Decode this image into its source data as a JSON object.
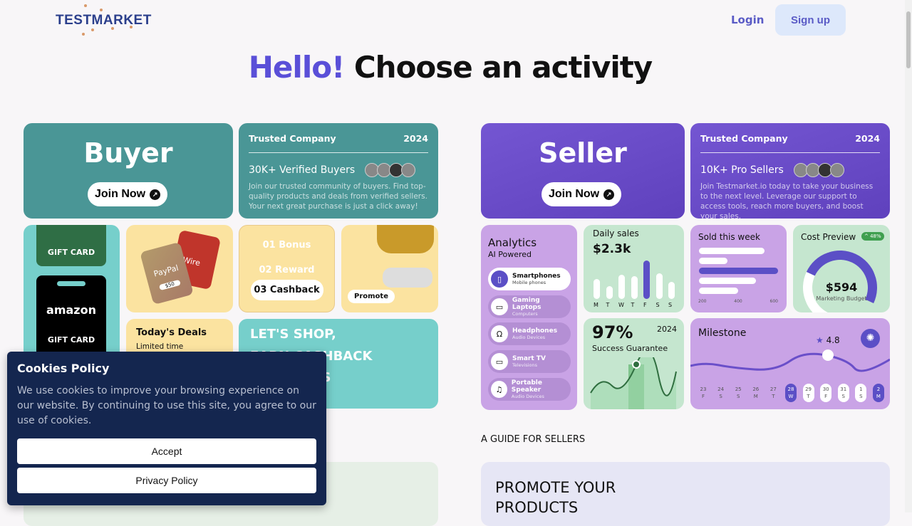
{
  "header": {
    "logo": "TESTMARKET",
    "login": "Login",
    "signup": "Sign up"
  },
  "hero": {
    "hello": "Hello!",
    "title": "Choose an activity"
  },
  "buyer": {
    "title": "Buyer",
    "join": "Join Now",
    "trusted": "Trusted Company",
    "year": "2024",
    "headline": "30K+ Verified Buyers",
    "desc": "Join our trusted community of buyers. Find top-quality products and deals from verified sellers. Your next great purchase is just a click away!",
    "giftcard1": "GIFT CARD",
    "amazon": "amazon",
    "giftcard2": "GIFT CARD",
    "paypal": "PayPal",
    "wire": "Wire",
    "amount": "$50",
    "bonus": "01 Bonus",
    "reward": "02 Reward",
    "cashback": "03 Cashback",
    "promote": "Promote",
    "deals": "Today's Deals",
    "limited": "Limited time",
    "shop1": "LET'S SHOP,",
    "shop2": "EARN CASHBACK",
    "shop3": "AND COINS"
  },
  "seller": {
    "title": "Seller",
    "join": "Join Now",
    "trusted": "Trusted Company",
    "year": "2024",
    "headline": "10K+ Pro Sellers",
    "desc": "Join Testmarket.io today to take your business to the next level. Leverage our support to access tools, reach more buyers, and boost your sales.",
    "analytics": "Analytics",
    "ai": "AI Powered",
    "items": [
      {
        "t": "Smartphones",
        "s": "Mobile phones",
        "icon": "phone"
      },
      {
        "t": "Gaming Laptops",
        "s": "Computers",
        "icon": "laptop"
      },
      {
        "t": "Headphones",
        "s": "Audio Devices",
        "icon": "headphones"
      },
      {
        "t": "Smart TV",
        "s": "Televisions",
        "icon": "tv"
      },
      {
        "t": "Portable Speaker",
        "s": "Audio Devices",
        "icon": "music"
      }
    ],
    "daily": "Daily sales",
    "daily_value": "$2.3k",
    "days": [
      "M",
      "T",
      "W",
      "T",
      "F",
      "S",
      "S"
    ],
    "sold": "Sold this week",
    "sold_ticks": [
      "200",
      "400",
      "600"
    ],
    "cost": "Cost Preview",
    "cost_badge": "^ 48%",
    "cost_value": "$594",
    "cost_label": "Marketing Budget",
    "success_pct": "97%",
    "success_year": "2024",
    "success": "Success Guarantee",
    "milestone": "Milestone",
    "rating": "4.8",
    "dates": [
      [
        "23",
        "F"
      ],
      [
        "24",
        "S"
      ],
      [
        "25",
        "S"
      ],
      [
        "26",
        "M"
      ],
      [
        "27",
        "T"
      ],
      [
        "28",
        "W"
      ],
      [
        "29",
        "T"
      ],
      [
        "30",
        "F"
      ],
      [
        "31",
        "S"
      ],
      [
        "1",
        "S"
      ],
      [
        "2",
        "M"
      ]
    ]
  },
  "guide": {
    "label": "A GUIDE FOR SELLERS",
    "promo": "PROMOTE YOUR PRODUCTS"
  },
  "cookie": {
    "title": "Cookies Policy",
    "text": "We use cookies to improve your browsing experience on our website. By continuing to use this site, you agree to our use of cookies.",
    "accept": "Accept",
    "privacy": "Privacy Policy"
  },
  "colors": {
    "teal": "#4a9696",
    "purple": "#6a4fc9",
    "accent": "#5a4fd8",
    "navy": "#14264f"
  }
}
